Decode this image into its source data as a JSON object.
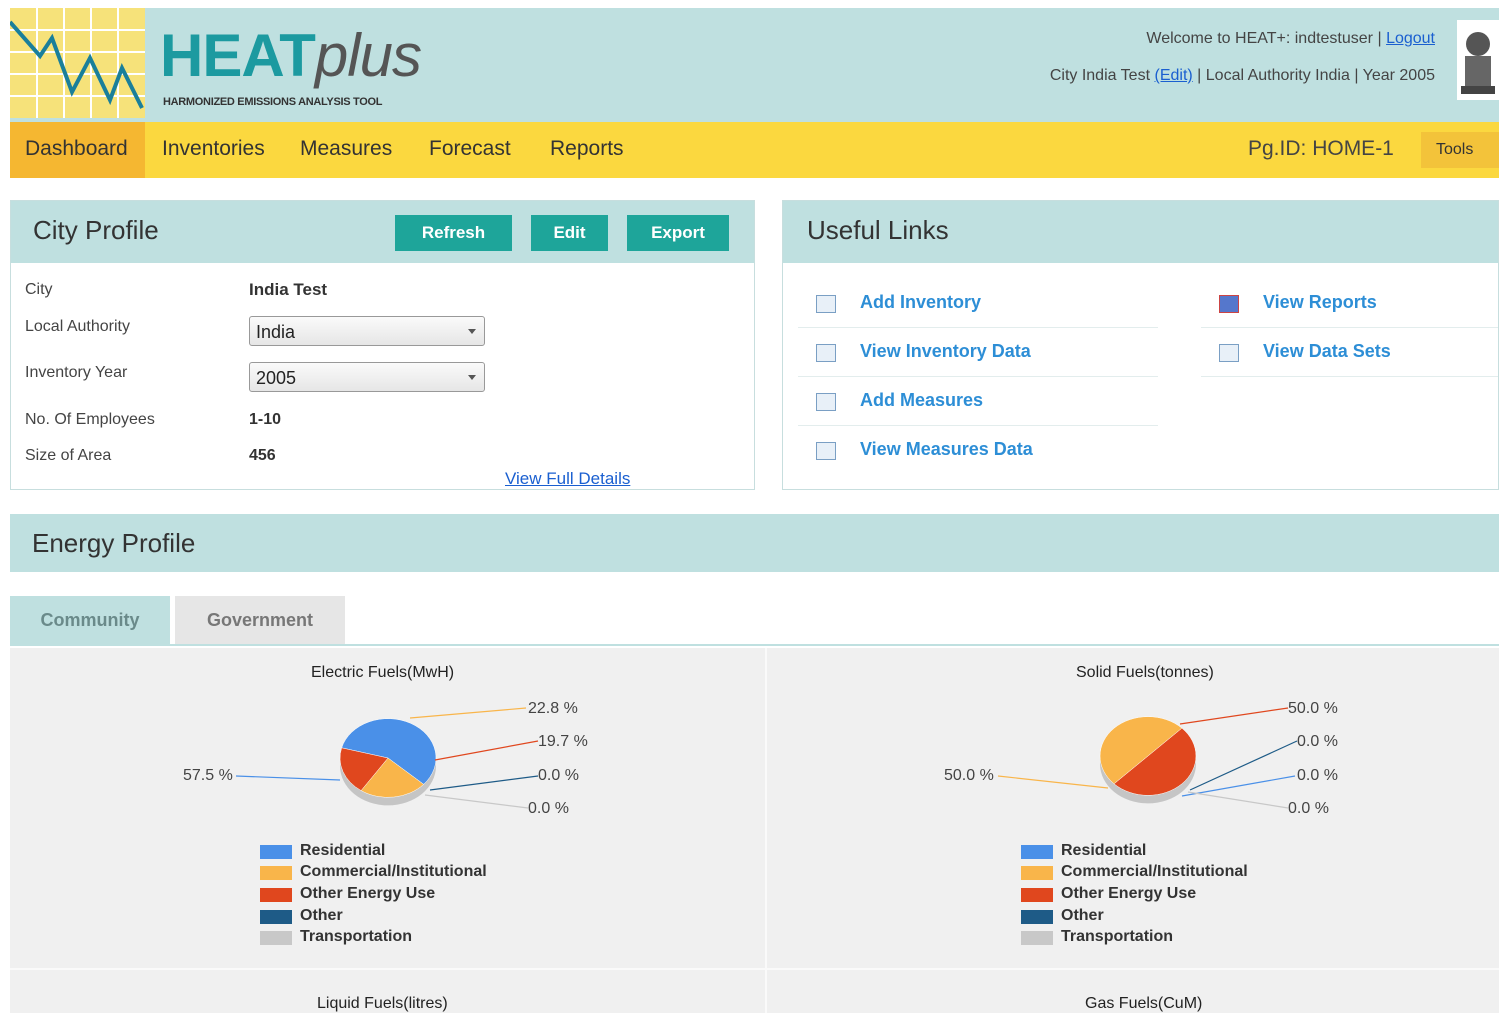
{
  "header": {
    "logo_heat": "HEAT",
    "logo_plus": "plus",
    "logo_subtitle": "HARMONIZED EMISSIONS ANALYSIS TOOL",
    "welcome_text": "Welcome to HEAT+: indtestuser |",
    "logout_label": "Logout",
    "city_prefix": "City  India Test",
    "edit_label": "(Edit)",
    "city_suffix": " | Local Authority India | Year 2005"
  },
  "nav": {
    "items": [
      "Dashboard",
      "Inventories",
      "Measures",
      "Forecast",
      "Reports"
    ],
    "active": "Dashboard",
    "page_id": "Pg.ID: HOME-1",
    "tools_label": "Tools"
  },
  "city_profile": {
    "title": "City Profile",
    "buttons": {
      "refresh": "Refresh",
      "edit": "Edit",
      "export": "Export"
    },
    "fields": {
      "city_label": "City",
      "city_value": "India Test",
      "authority_label": "Local Authority",
      "authority_value": "India",
      "year_label": "Inventory Year",
      "year_value": "2005",
      "employees_label": "No. Of Employees",
      "employees_value": "1-10",
      "area_label": "Size of Area",
      "area_value": "456"
    },
    "details_link": "View Full Details"
  },
  "useful_links": {
    "title": "Useful Links",
    "left": [
      "Add Inventory",
      "View Inventory Data",
      "Add Measures",
      "View Measures Data"
    ],
    "right": [
      "View Reports",
      "View Data Sets"
    ]
  },
  "energy_profile": {
    "title": "Energy Profile",
    "tabs": [
      "Community",
      "Government"
    ],
    "active_tab": "Community"
  },
  "colors": {
    "Residential": "#4a90e8",
    "Commercial/Institutional": "#f9b54a",
    "Other Energy Use": "#e0471e",
    "Other": "#1e5b87",
    "Transportation": "#c8c8c8"
  },
  "chart_data": [
    {
      "type": "pie",
      "title": "Electric Fuels(MwH)",
      "labels": [
        "Residential",
        "Commercial/Institutional",
        "Other Energy Use",
        "Other",
        "Transportation"
      ],
      "values": [
        57.5,
        22.8,
        19.7,
        0.0,
        0.0
      ],
      "value_labels": [
        "57.5 %",
        "22.8 %",
        "19.7 %",
        "0.0 %",
        "0.0 %"
      ]
    },
    {
      "type": "pie",
      "title": "Solid Fuels(tonnes)",
      "labels": [
        "Residential",
        "Commercial/Institutional",
        "Other Energy Use",
        "Other",
        "Transportation"
      ],
      "values": [
        0.0,
        50.0,
        50.0,
        0.0,
        0.0
      ],
      "value_labels": [
        "0.0 %",
        "50.0 %",
        "50.0 %",
        "0.0 %",
        "0.0 %"
      ]
    },
    {
      "type": "pie",
      "title": "Liquid Fuels(litres)"
    },
    {
      "type": "pie",
      "title": "Gas Fuels(CuM)"
    }
  ]
}
